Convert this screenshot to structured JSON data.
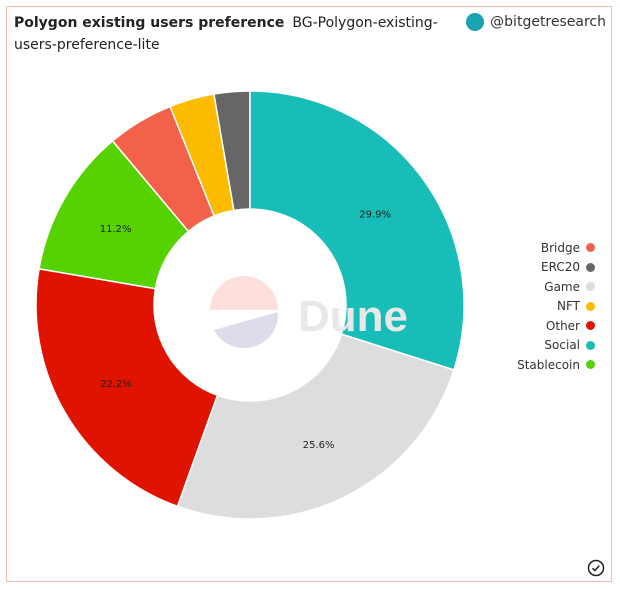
{
  "header": {
    "title": "Polygon existing users preference",
    "query_name": "BG-Polygon-existing-users-preference-lite",
    "author": "@bitgetresearch",
    "watermark": "Dune"
  },
  "chart_data": {
    "type": "pie",
    "donut": true,
    "legend_position": "right",
    "categories": [
      "Social",
      "Game",
      "Other",
      "Stablecoin",
      "Bridge",
      "NFT",
      "ERC20"
    ],
    "values": [
      29.9,
      25.6,
      22.2,
      11.2,
      5.0,
      3.4,
      2.7
    ],
    "data_labels": [
      "29.9%",
      "25.6%",
      "22.2%",
      "11.2%",
      "",
      "",
      ""
    ],
    "colors": {
      "Bridge": "#f4614a",
      "ERC20": "#666666",
      "Game": "#dddddd",
      "NFT": "#fdbb00",
      "Other": "#e01200",
      "Social": "#17bdb6",
      "Stablecoin": "#55d200"
    },
    "legend": [
      "Bridge",
      "ERC20",
      "Game",
      "NFT",
      "Other",
      "Social",
      "Stablecoin"
    ]
  }
}
